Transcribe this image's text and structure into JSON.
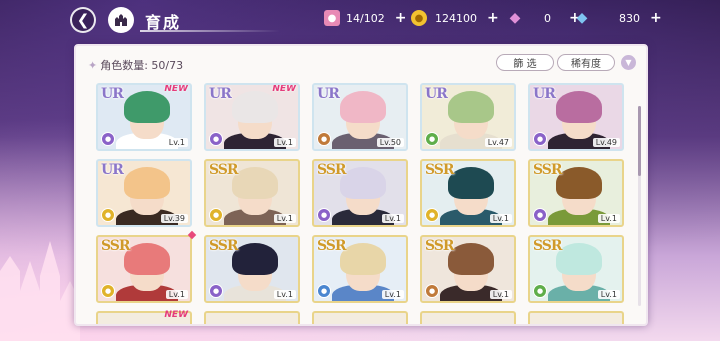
{
  "header": {
    "title": "育成",
    "back_icon": "back-arrow-icon",
    "home_icon": "castle-home-icon"
  },
  "resources": [
    {
      "name": "candy",
      "icon": "candy-icon",
      "value": "14/102",
      "color": "#e88ab5"
    },
    {
      "name": "gold",
      "icon": "gold-coin-icon",
      "value": "124100",
      "color": "#f2c230"
    },
    {
      "name": "gem-pink",
      "icon": "pink-diamond-icon",
      "value": "0",
      "color": "#e090d8"
    },
    {
      "name": "gem-blue",
      "icon": "blue-diamond-icon",
      "value": "830",
      "color": "#7fc4f0"
    }
  ],
  "panel": {
    "count_label": "角色数量: 50/73",
    "filter_label": "篩 选",
    "rarity_label": "稀有度",
    "sort_icon": "sort-down-icon"
  },
  "cards": [
    {
      "rarity": "UR",
      "level": "Lv.1",
      "new": "NEW",
      "attr_color": "#8a62c8",
      "hair": "#3f9a6a",
      "body": "#ffffff",
      "bg": "#dfe9f3"
    },
    {
      "rarity": "UR",
      "level": "Lv.1",
      "new": "NEW",
      "attr_color": "#8a62c8",
      "hair": "#eae6e6",
      "body": "#2e2434",
      "bg": "#f0e4e4"
    },
    {
      "rarity": "UR",
      "level": "Lv.50",
      "new": "",
      "attr_color": "#c07a3a",
      "hair": "#f0b7c6",
      "body": "#6a6070",
      "bg": "#e7eef2"
    },
    {
      "rarity": "UR",
      "level": "Lv.47",
      "new": "",
      "attr_color": "#5fae4a",
      "hair": "#a8c789",
      "body": "#e6dfcf",
      "bg": "#f1ecd8"
    },
    {
      "rarity": "UR",
      "level": "Lv.49",
      "new": "",
      "attr_color": "#8a62c8",
      "hair": "#b96da0",
      "body": "#2f2432",
      "bg": "#ead8e6"
    },
    {
      "rarity": "UR",
      "level": "Lv.39",
      "new": "",
      "attr_color": "#e0b32a",
      "hair": "#f3c48a",
      "body": "#3a2a22",
      "bg": "#f6e7d3"
    },
    {
      "rarity": "SSR",
      "level": "Lv.1",
      "new": "",
      "attr_color": "#e0b32a",
      "hair": "#e8d7b7",
      "body": "#7d6356",
      "bg": "#efe5d6"
    },
    {
      "rarity": "SSR",
      "level": "Lv.1",
      "new": "",
      "attr_color": "#8a62c8",
      "hair": "#d9d4e8",
      "body": "#2a2a3a",
      "bg": "#e2e0ea"
    },
    {
      "rarity": "SSR",
      "level": "Lv.1",
      "new": "",
      "attr_color": "#e0b32a",
      "hair": "#1e4a52",
      "body": "#2a5a6a",
      "bg": "#e4eef0"
    },
    {
      "rarity": "SSR",
      "level": "Lv.1",
      "new": "",
      "attr_color": "#8a62c8",
      "hair": "#8a5a2a",
      "body": "#7a9a3a",
      "bg": "#e8efdd"
    },
    {
      "rarity": "SSR",
      "level": "Lv.1",
      "new": "",
      "attr_color": "#e0b32a",
      "hair": "#e87a7a",
      "body": "#b03a3a",
      "bg": "#f6e0de"
    },
    {
      "rarity": "SSR",
      "level": "Lv.1",
      "new": "",
      "attr_color": "#8a62c8",
      "hair": "#22223a",
      "body": "#e8e3da",
      "bg": "#e0e6ee"
    },
    {
      "rarity": "SSR",
      "level": "Lv.1",
      "new": "",
      "attr_color": "#4a86d0",
      "hair": "#e8d6a8",
      "body": "#5a86c8",
      "bg": "#e6eef6"
    },
    {
      "rarity": "SSR",
      "level": "Lv.1",
      "new": "",
      "attr_color": "#c07a3a",
      "hair": "#8a5a3a",
      "body": "#3a2a2a",
      "bg": "#efe6dc"
    },
    {
      "rarity": "SSR",
      "level": "Lv.1",
      "new": "",
      "attr_color": "#5fae4a",
      "hair": "#bfe8df",
      "body": "#6ab0a8",
      "bg": "#e4f2ee"
    }
  ],
  "partial_row_new": "NEW"
}
